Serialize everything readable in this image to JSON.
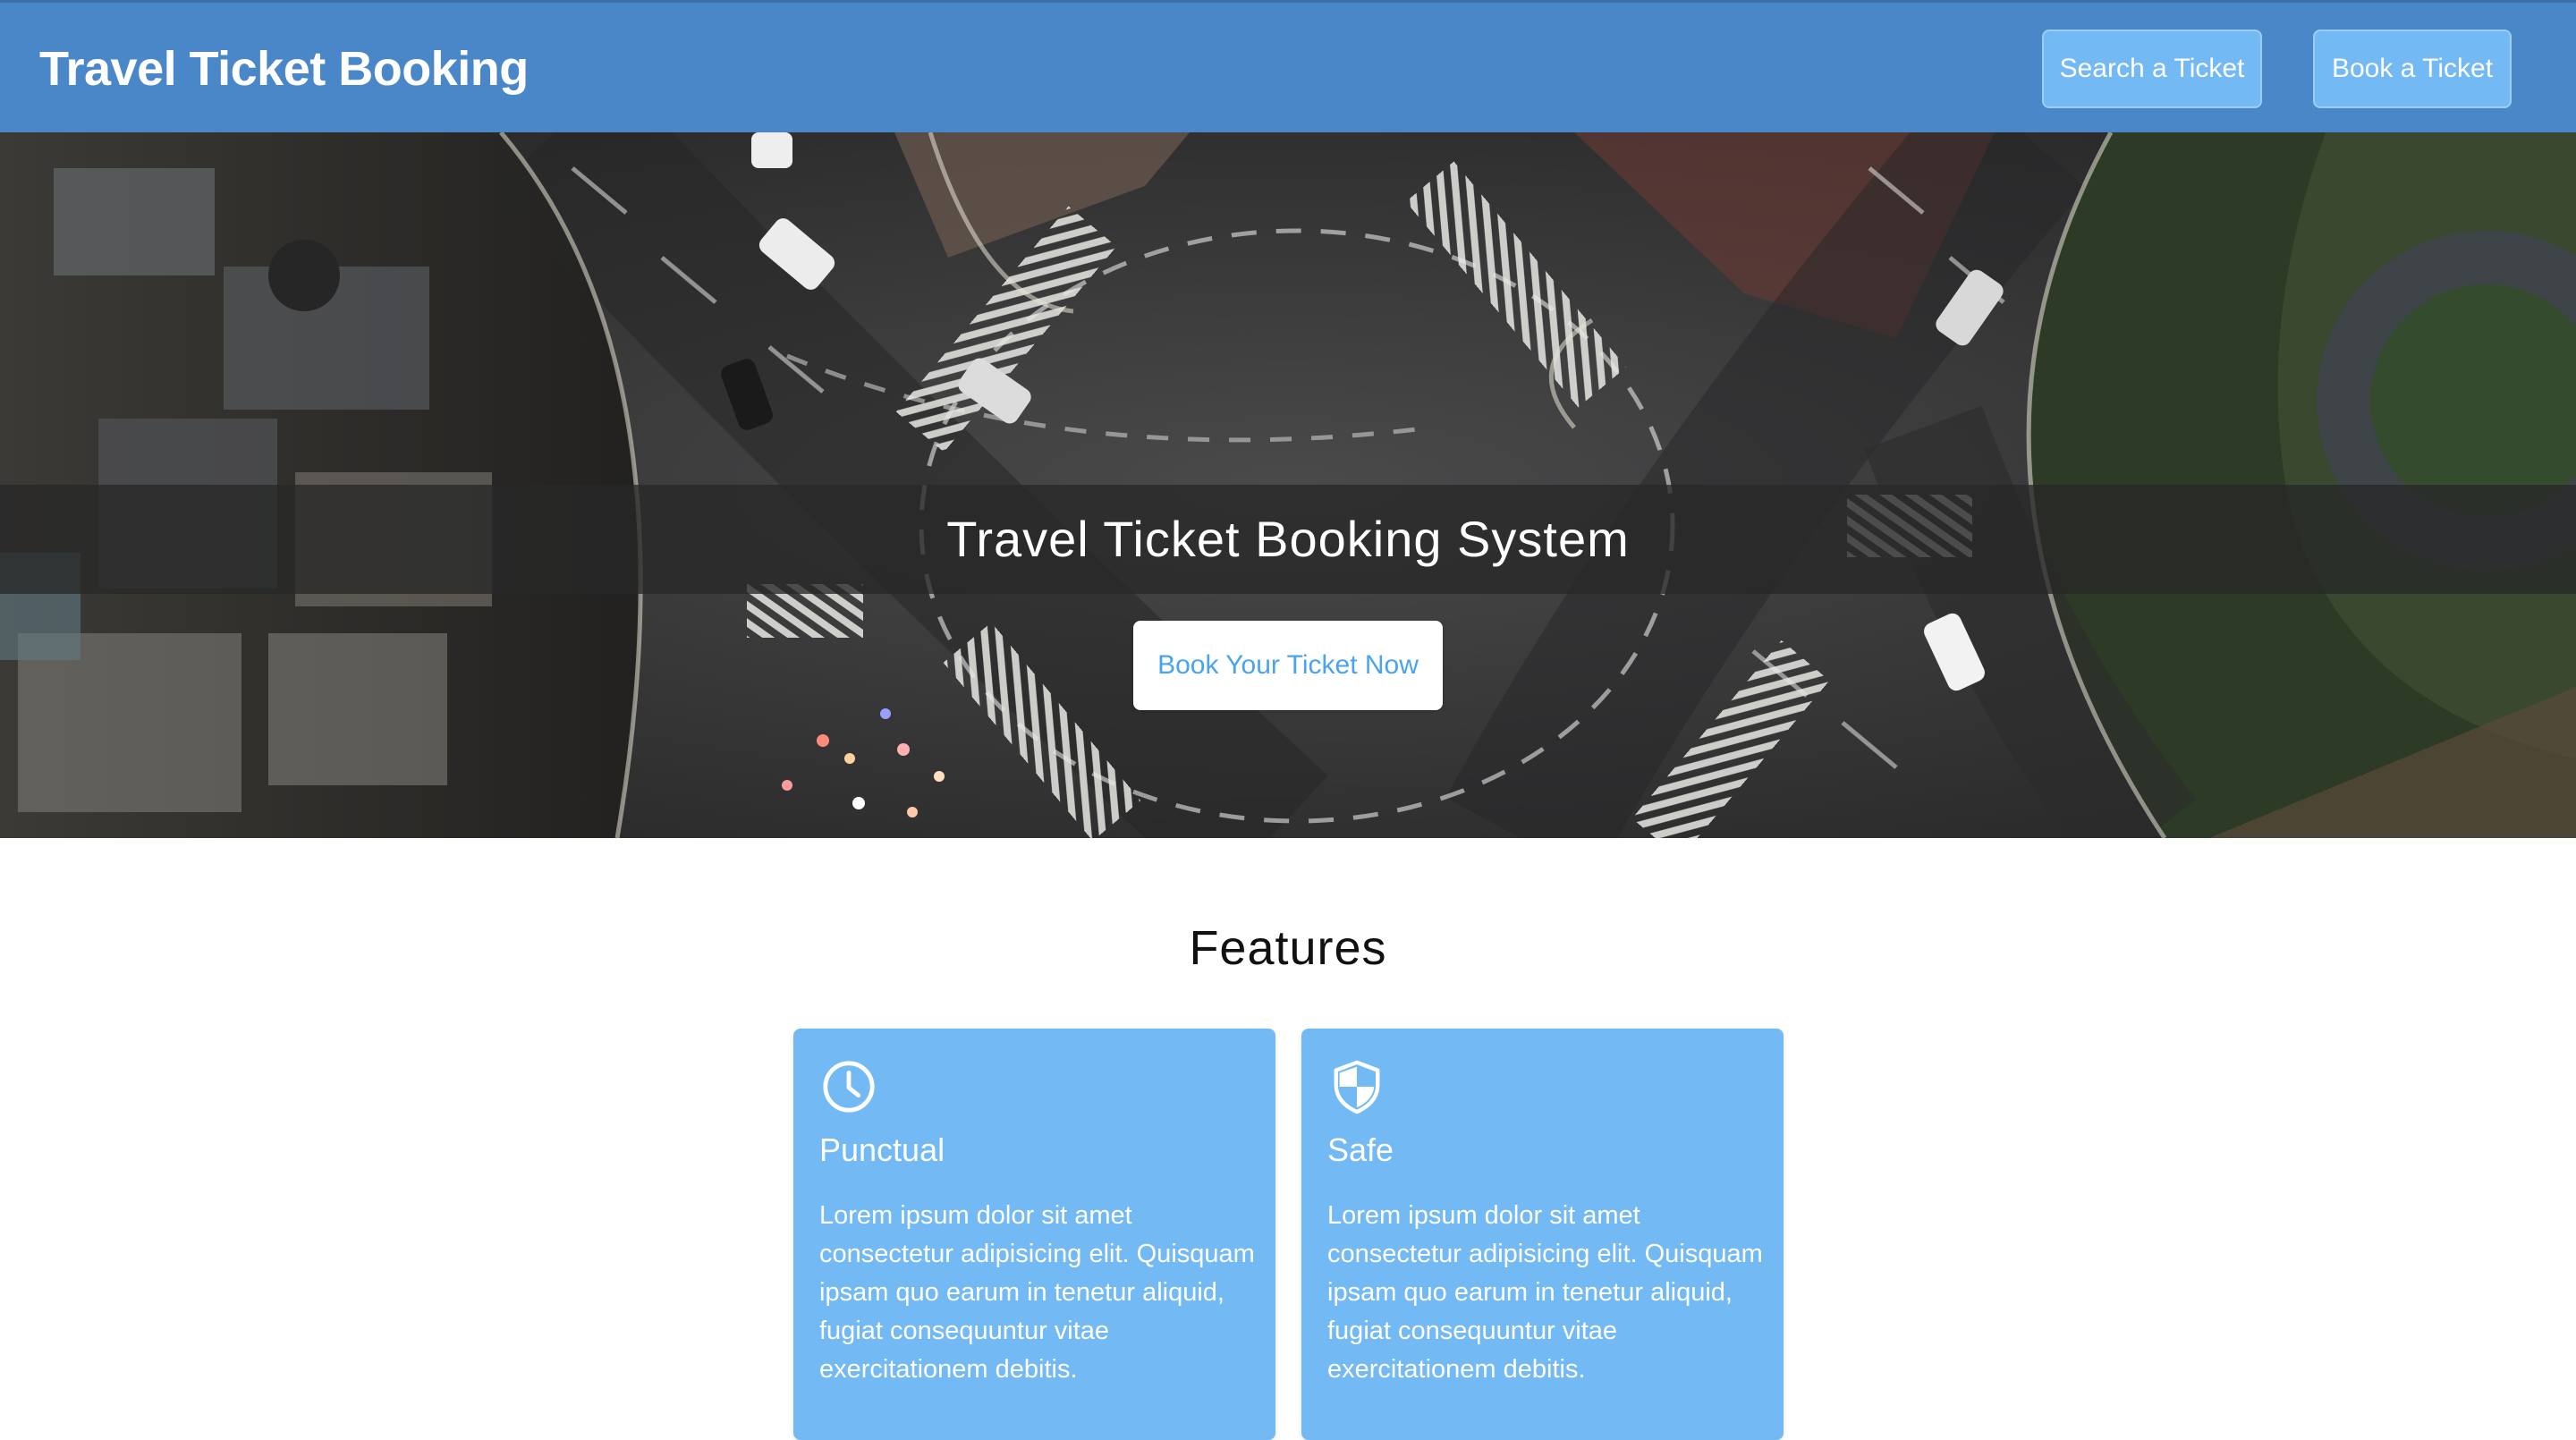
{
  "header": {
    "brand": "Travel Ticket Booking",
    "nav": {
      "search_label": "Search a Ticket",
      "book_label": "Book a Ticket"
    },
    "background_color": "#4a87c8",
    "button_color": "#73b9f3"
  },
  "hero": {
    "title": "Travel Ticket Booking System",
    "cta_label": "Book Your Ticket Now",
    "cta_text_color": "#4aa3ee"
  },
  "features": {
    "heading": "Features",
    "cards": [
      {
        "icon": "clock-icon",
        "title": "Punctual",
        "text": "Lorem ipsum dolor sit amet consectetur adipisicing elit. Quisquam ipsam quo earum in tenetur aliquid, fugiat consequuntur vitae exercitationem debitis."
      },
      {
        "icon": "shield-icon",
        "title": "Safe",
        "text": "Lorem ipsum dolor sit amet consectetur adipisicing elit. Quisquam ipsam quo earum in tenetur aliquid, fugiat consequuntur vitae exercitationem debitis."
      }
    ],
    "card_color": "#73b9f3"
  }
}
